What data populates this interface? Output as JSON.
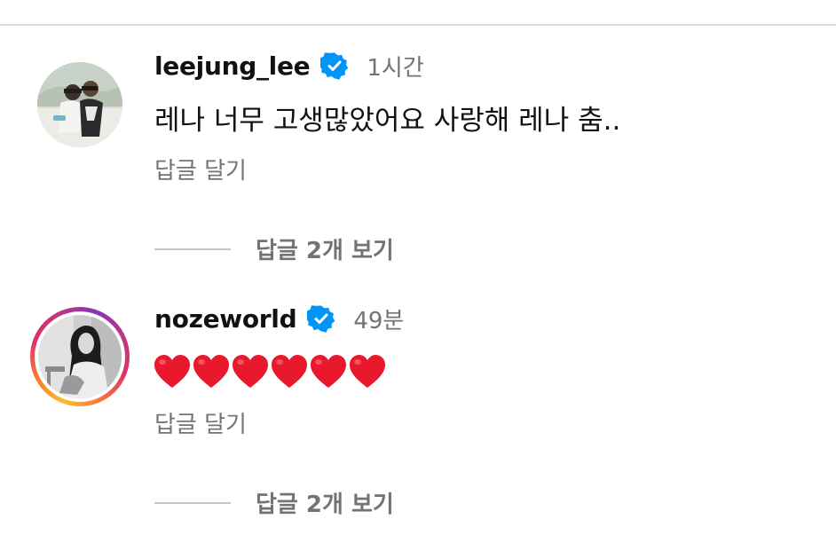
{
  "comments": [
    {
      "username": "leejung_lee",
      "verified": true,
      "time": "1시간",
      "text": "레나 너무 고생많았어요 사랑해 레나 춤..",
      "reply_label": "답글 달기",
      "view_replies_label": "답글 2개 보기",
      "has_story_ring": false
    },
    {
      "username": "nozeworld",
      "verified": true,
      "time": "49분",
      "text": "❤️❤️❤️❤️❤️❤️",
      "heart_count": 6,
      "reply_label": "답글 달기",
      "view_replies_label": "답글 2개 보기",
      "has_story_ring": true
    }
  ],
  "colors": {
    "verified_badge": "#0095f6",
    "secondary_text": "#737373",
    "heart": "#e8192c"
  },
  "icons": {
    "verified": "verified-badge-icon",
    "heart": "heart-icon"
  }
}
